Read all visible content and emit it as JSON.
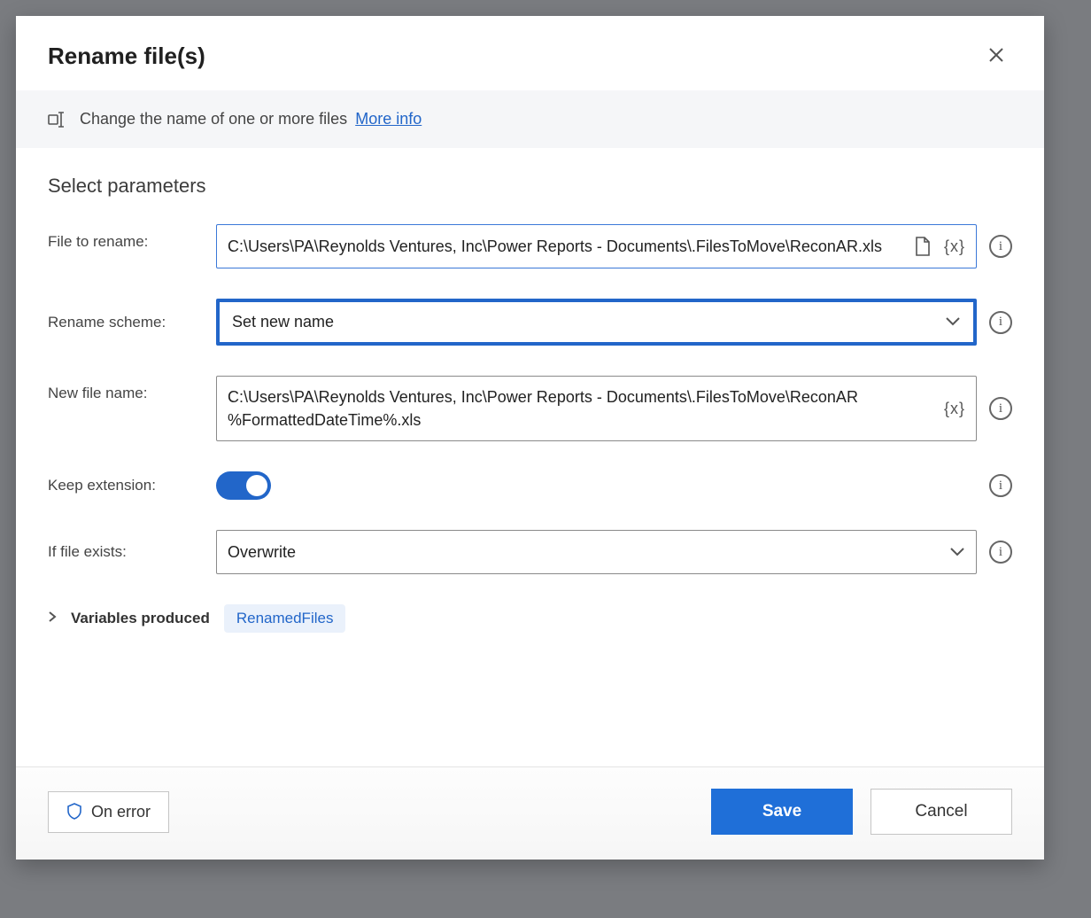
{
  "dialog": {
    "title": "Rename file(s)",
    "description": "Change the name of one or more files",
    "more_info": "More info",
    "section_title": "Select parameters",
    "fields": {
      "file_to_rename": {
        "label": "File to rename:",
        "value": "C:\\Users\\PA\\Reynolds Ventures, Inc\\Power Reports - Documents\\.FilesToMove\\ReconAR.xls"
      },
      "rename_scheme": {
        "label": "Rename scheme:",
        "value": "Set new name"
      },
      "new_file_name": {
        "label": "New file name:",
        "value": "C:\\Users\\PA\\Reynolds Ventures, Inc\\Power Reports - Documents\\.FilesToMove\\ReconAR %FormattedDateTime%.xls"
      },
      "keep_extension": {
        "label": "Keep extension:",
        "on": true
      },
      "if_file_exists": {
        "label": "If file exists:",
        "value": "Overwrite"
      }
    },
    "variables_produced": {
      "label": "Variables produced",
      "items": [
        "RenamedFiles"
      ]
    },
    "buttons": {
      "on_error": "On error",
      "save": "Save",
      "cancel": "Cancel"
    },
    "icons": {
      "variable_token": "{x}"
    }
  }
}
